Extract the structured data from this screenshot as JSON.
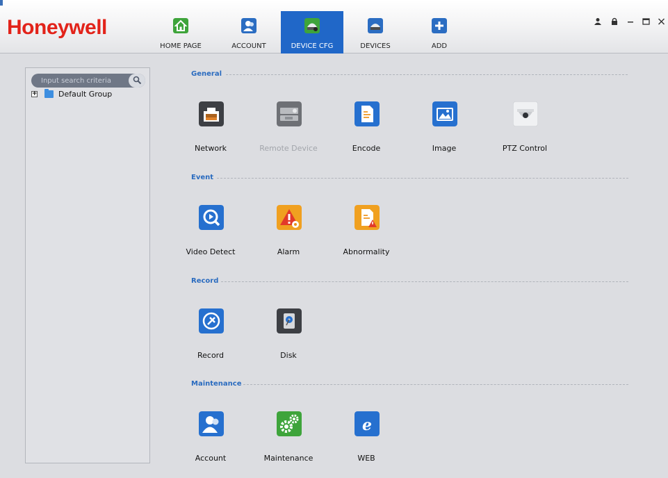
{
  "app": {
    "logo": "Honeywell",
    "colors": {
      "brand": "#e2231a",
      "active_tab": "#2067c8",
      "section_title": "#2a6bbf"
    }
  },
  "tabs": [
    {
      "label": "HOME PAGE",
      "icon": "home-icon",
      "active": false
    },
    {
      "label": "ACCOUNT",
      "icon": "account-icon",
      "active": false
    },
    {
      "label": "DEVICE CFG",
      "icon": "device-cfg-icon",
      "active": true
    },
    {
      "label": "DEVICES",
      "icon": "devices-icon",
      "active": false
    },
    {
      "label": "ADD",
      "icon": "add-icon",
      "active": false
    }
  ],
  "window_controls": {
    "user": "user-icon",
    "lock": "lock-icon",
    "minimize": "minimize-icon",
    "maximize": "maximize-icon",
    "close": "close-icon"
  },
  "sidebar": {
    "search_placeholder": "Input search criteria",
    "tree": [
      {
        "label": "Default Group",
        "expander": "+"
      }
    ]
  },
  "sections": {
    "general": {
      "title": "General",
      "items": [
        {
          "label": "Network",
          "icon": "network-port-icon",
          "enabled": true
        },
        {
          "label": "Remote Device",
          "icon": "remote-device-icon",
          "enabled": false
        },
        {
          "label": "Encode",
          "icon": "encode-document-icon",
          "enabled": true
        },
        {
          "label": "Image",
          "icon": "image-icon",
          "enabled": true
        },
        {
          "label": "PTZ Control",
          "icon": "ptz-dome-camera-icon",
          "enabled": true
        }
      ]
    },
    "event": {
      "title": "Event",
      "items": [
        {
          "label": "Video Detect",
          "icon": "video-detect-icon",
          "enabled": true
        },
        {
          "label": "Alarm",
          "icon": "alarm-warning-icon",
          "enabled": true
        },
        {
          "label": "Abnormality",
          "icon": "abnormality-icon",
          "enabled": true
        }
      ]
    },
    "record": {
      "title": "Record",
      "items": [
        {
          "label": "Record",
          "icon": "record-icon",
          "enabled": true
        },
        {
          "label": "Disk",
          "icon": "disk-icon",
          "enabled": true
        }
      ]
    },
    "maintenance": {
      "title": "Maintenance",
      "items": [
        {
          "label": "Account",
          "icon": "account-user-icon",
          "enabled": true
        },
        {
          "label": "Maintenance",
          "icon": "maintenance-gears-icon",
          "enabled": true
        },
        {
          "label": "WEB",
          "icon": "web-browser-icon",
          "enabled": true
        }
      ]
    }
  }
}
